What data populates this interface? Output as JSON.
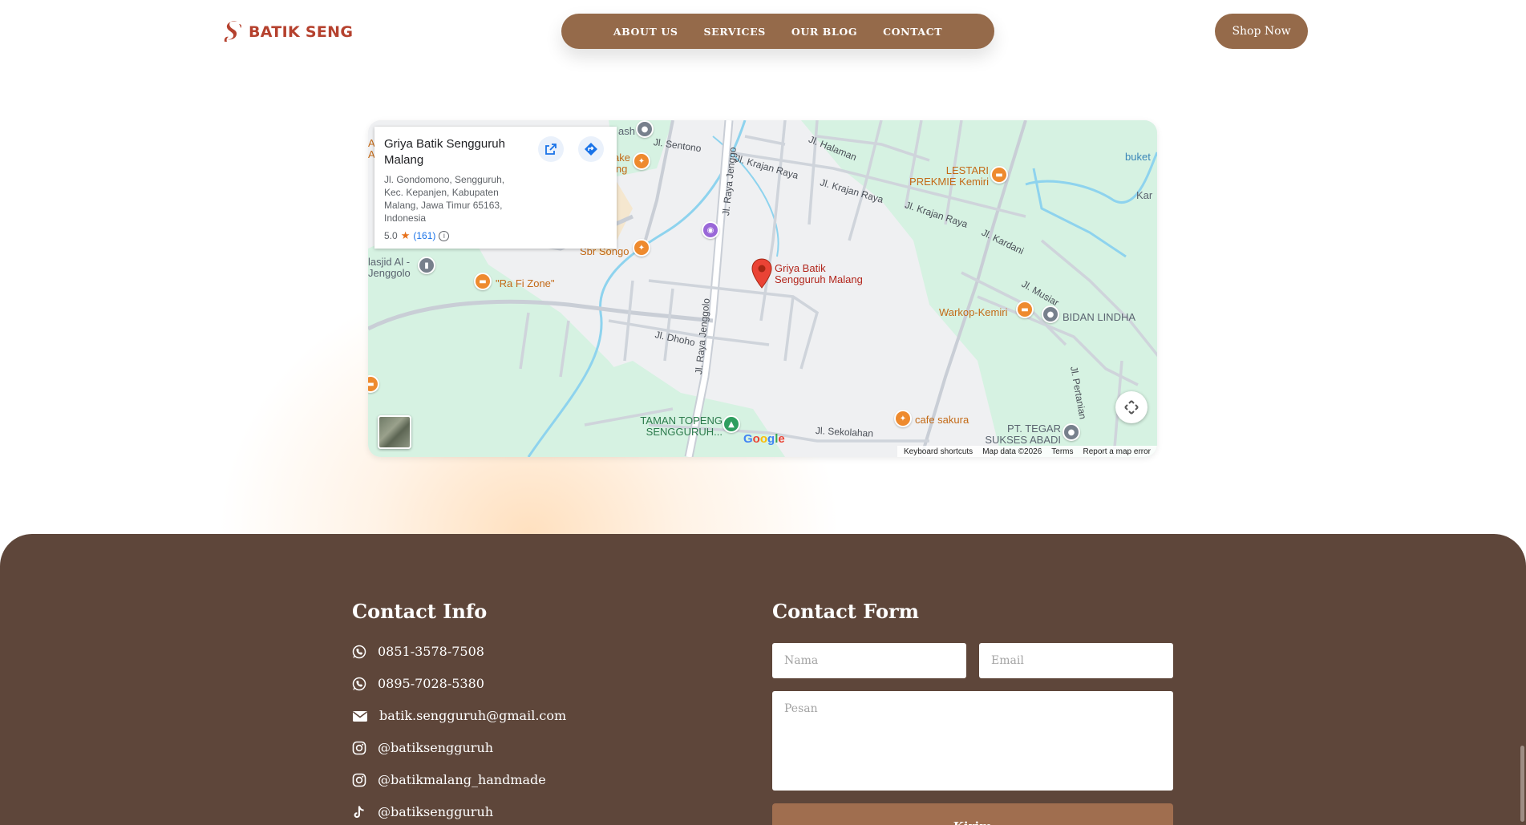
{
  "brand": {
    "name": "BATIK SENG",
    "color": "#b5412e"
  },
  "nav": {
    "items": [
      {
        "label": "ABOUT US"
      },
      {
        "label": "SERVICES"
      },
      {
        "label": "OUR BLOG"
      },
      {
        "label": "CONTACT"
      }
    ],
    "color": "#956a4a"
  },
  "shop_button": {
    "label": "Shop Now"
  },
  "map": {
    "place": {
      "name": "Griya Batik Sengguruh Malang",
      "address": "Jl. Gondomono, Sengguruh, Kec. Kepanjen, Kabupaten Malang, Jawa Timur 65163, Indonesia",
      "rating": "5.0",
      "reviews": "(161)"
    },
    "marker_label": "Griya Batik Sengguruh Malang",
    "labels": {
      "lestari": "LESTARI PREKMIE Kemiri",
      "buket": "buket",
      "kar": "Kar",
      "sbr_songo": "Sbr Songo",
      "masjid": "lasjid Al - Jenggolo",
      "rafi": "\"Ra Fi Zone\"",
      "warkop": "Warkop-Kemiri",
      "bidan": "BIDAN LINDHA",
      "cafe_sakura": "cafe sakura",
      "taman": "TAMAN TOPENG SENGGURUH...",
      "pt_tegar": "PT. TEGAR SUKSES ABADI",
      "ake": "ake ing",
      "ash": "ash",
      "a_left": "A A"
    },
    "roads": {
      "sentono": "Jl. Sentono",
      "halaman": "Jl. Halaman",
      "krajan1": "Jl. Krajan Raya",
      "krajan2": "Jl. Krajan Raya",
      "krajan3": "Jl. Krajan Raya",
      "kardani": "Jl. Kardani",
      "musiar": "Jl. Musiar",
      "pertanian": "Jl. Pertanian",
      "dhoho": "Jl. Dhoho",
      "raya_jenggolo": "Jl. Raya Jenggolo",
      "raya_jenggo_top": "Jl. Raya Jenggo",
      "sekolahan": "Jl. Sekolahan"
    },
    "google": "Google",
    "footer": [
      "Keyboard shortcuts",
      "Map data ©2026",
      "Terms",
      "Report a map error"
    ]
  },
  "contact_info": {
    "title": "Contact Info",
    "items": [
      {
        "icon": "whatsapp-icon",
        "text": "0851-3578-7508"
      },
      {
        "icon": "whatsapp-icon",
        "text": "0895-7028-5380"
      },
      {
        "icon": "mail-icon",
        "text": "batik.sengguruh@gmail.com"
      },
      {
        "icon": "instagram-icon",
        "text": "@batiksengguruh"
      },
      {
        "icon": "instagram-icon",
        "text": "@batikmalang_handmade"
      },
      {
        "icon": "tiktok-icon",
        "text": "@batiksengguruh"
      }
    ]
  },
  "contact_form": {
    "title": "Contact Form",
    "name_placeholder": "Nama",
    "email_placeholder": "Email",
    "message_placeholder": "Pesan",
    "submit_label": "Kirim"
  },
  "colors": {
    "footer_bg": "#5e463a",
    "accent": "#956a4a",
    "submit": "#a06e4f"
  }
}
